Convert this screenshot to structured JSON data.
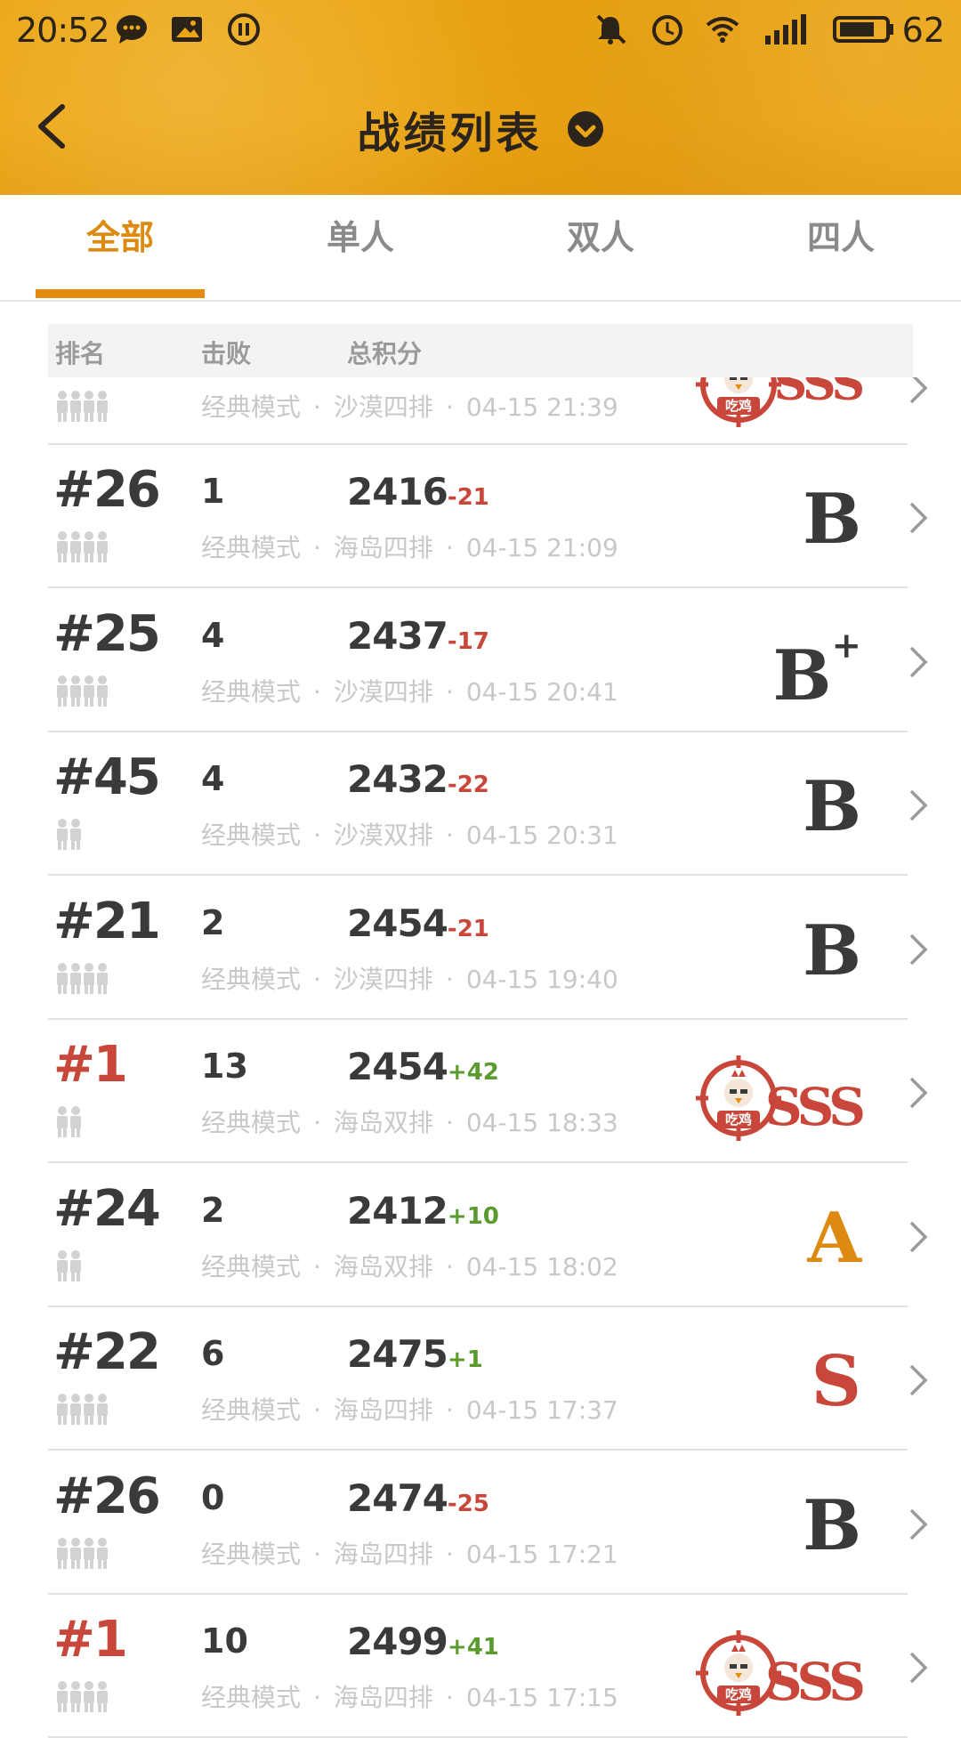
{
  "status_bar": {
    "time": "20:52",
    "battery": "62",
    "left_icons": [
      "chat-bubble-icon",
      "image-icon",
      "pause-icon"
    ],
    "right_icons": [
      "muted-bell-icon",
      "alarm-icon",
      "wifi-icon",
      "signal-icon",
      "battery-icon"
    ]
  },
  "header": {
    "title": "战绩列表",
    "back_icon": "back-arrow-icon",
    "dropdown_icon": "check-circle-icon",
    "bg_color": "#eba515"
  },
  "tabs": [
    {
      "label": "全部",
      "active": true
    },
    {
      "label": "单人",
      "active": false
    },
    {
      "label": "双人",
      "active": false
    },
    {
      "label": "四人",
      "active": false
    }
  ],
  "table_header": {
    "rank": "排名",
    "kills": "击败",
    "score": "总积分"
  },
  "partial_row": {
    "mode": "经典模式",
    "map": "沙漠四排",
    "time": "04-15 21:39",
    "grade": "SSS",
    "badge": "吃鸡",
    "team_size": 4
  },
  "rows": [
    {
      "rank": "#26",
      "kills": "1",
      "score": "2416",
      "delta": "-21",
      "delta_sign": "neg",
      "mode": "经典模式",
      "map": "海岛四排",
      "time": "04-15 21:09",
      "grade": "B",
      "grade_plus": "",
      "team_size": 4,
      "chicken": false
    },
    {
      "rank": "#25",
      "kills": "4",
      "score": "2437",
      "delta": "-17",
      "delta_sign": "neg",
      "mode": "经典模式",
      "map": "沙漠四排",
      "time": "04-15 20:41",
      "grade": "B",
      "grade_plus": "+",
      "team_size": 4,
      "chicken": false
    },
    {
      "rank": "#45",
      "kills": "4",
      "score": "2432",
      "delta": "-22",
      "delta_sign": "neg",
      "mode": "经典模式",
      "map": "沙漠双排",
      "time": "04-15 20:31",
      "grade": "B",
      "grade_plus": "",
      "team_size": 2,
      "chicken": false
    },
    {
      "rank": "#21",
      "kills": "2",
      "score": "2454",
      "delta": "-21",
      "delta_sign": "neg",
      "mode": "经典模式",
      "map": "沙漠四排",
      "time": "04-15 19:40",
      "grade": "B",
      "grade_plus": "",
      "team_size": 4,
      "chicken": false
    },
    {
      "rank": "#1",
      "kills": "13",
      "score": "2454",
      "delta": "+42",
      "delta_sign": "pos",
      "mode": "经典模式",
      "map": "海岛双排",
      "time": "04-15 18:33",
      "grade": "SSS",
      "grade_plus": "",
      "team_size": 2,
      "chicken": true,
      "badge": "吃鸡"
    },
    {
      "rank": "#24",
      "kills": "2",
      "score": "2412",
      "delta": "+10",
      "delta_sign": "pos",
      "mode": "经典模式",
      "map": "海岛双排",
      "time": "04-15 18:02",
      "grade": "A",
      "grade_plus": "",
      "team_size": 2,
      "chicken": false
    },
    {
      "rank": "#22",
      "kills": "6",
      "score": "2475",
      "delta": "+1",
      "delta_sign": "pos",
      "mode": "经典模式",
      "map": "海岛四排",
      "time": "04-15 17:37",
      "grade": "S",
      "grade_plus": "",
      "team_size": 4,
      "chicken": false
    },
    {
      "rank": "#26",
      "kills": "0",
      "score": "2474",
      "delta": "-25",
      "delta_sign": "neg",
      "mode": "经典模式",
      "map": "海岛四排",
      "time": "04-15 17:21",
      "grade": "B",
      "grade_plus": "",
      "team_size": 4,
      "chicken": false
    },
    {
      "rank": "#1",
      "kills": "10",
      "score": "2499",
      "delta": "+41",
      "delta_sign": "pos",
      "mode": "经典模式",
      "map": "海岛四排",
      "time": "04-15 17:15",
      "grade": "SSS",
      "grade_plus": "",
      "team_size": 4,
      "chicken": true,
      "badge": "吃鸡"
    }
  ],
  "colors": {
    "accent": "#dd8a10",
    "win_red": "#c8473a",
    "gain_green": "#5a9a2e",
    "text_dark": "#3a3a3a",
    "meta_gray": "#c8c8c8"
  }
}
